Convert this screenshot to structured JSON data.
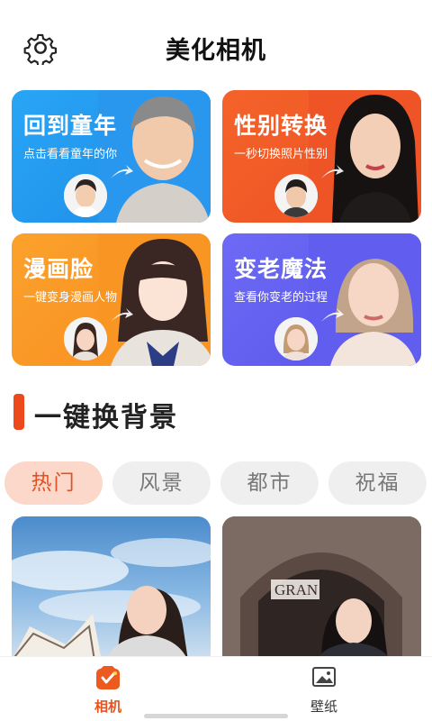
{
  "header": {
    "title": "美化相机",
    "settings_icon": "gear-icon"
  },
  "features": [
    {
      "title": "回到童年",
      "subtitle": "点击看看童年的你",
      "color": "#1f8ee8"
    },
    {
      "title": "性别转换",
      "subtitle": "一秒切换照片性别",
      "color": "#ef5624"
    },
    {
      "title": "漫画脸",
      "subtitle": "一键变身漫画人物",
      "color": "#fa951f"
    },
    {
      "title": "变老魔法",
      "subtitle": "查看你变老的过程",
      "color": "#5f5cee"
    }
  ],
  "section": {
    "title": "一键换背景",
    "accent": "#ec4a1c"
  },
  "categories": [
    {
      "label": "热门",
      "active": true
    },
    {
      "label": "风景",
      "active": false
    },
    {
      "label": "都市",
      "active": false
    },
    {
      "label": "祝福",
      "active": false
    }
  ],
  "gallery": [
    {
      "name": "sky-opera-house"
    },
    {
      "name": "arch-building",
      "sign_text": "GRAN"
    }
  ],
  "bottom_nav": [
    {
      "label": "相机",
      "icon": "camera-icon",
      "active": true,
      "color": "#e8541f"
    },
    {
      "label": "壁纸",
      "icon": "image-icon",
      "active": false,
      "color": "#333333"
    }
  ]
}
